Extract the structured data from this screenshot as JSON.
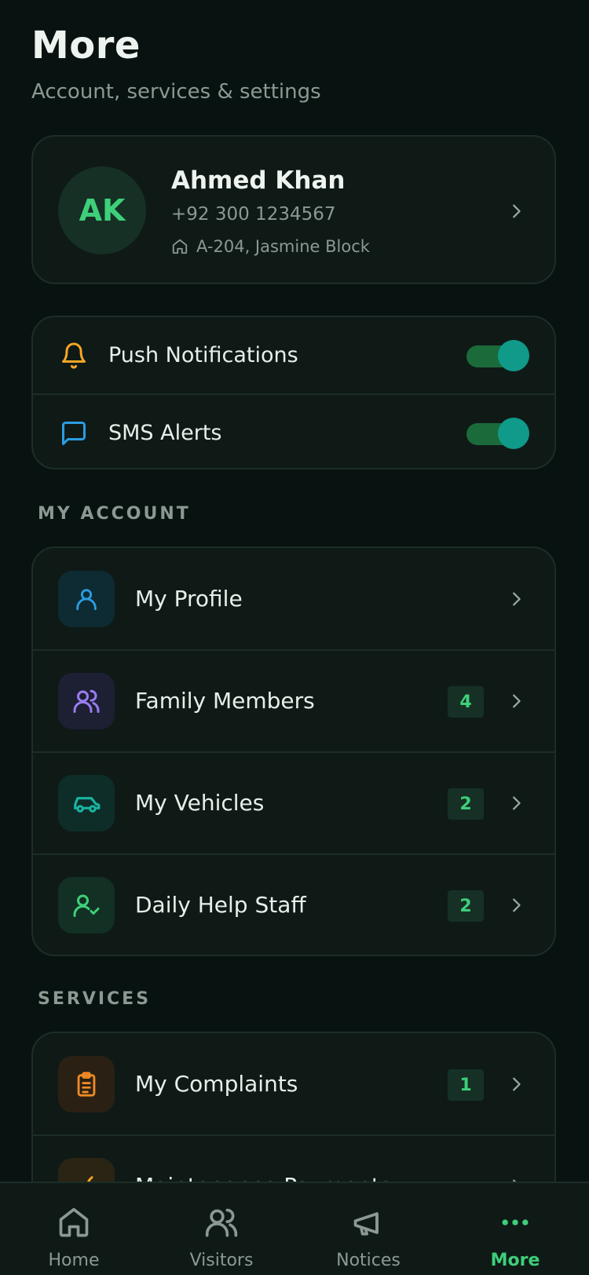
{
  "header": {
    "title": "More",
    "subtitle": "Account, services & settings"
  },
  "profile": {
    "initials": "AK",
    "name": "Ahmed Khan",
    "phone": "+92 300 1234567",
    "address": "A-204, Jasmine Block",
    "icons": {
      "address": "home-icon",
      "chevron": "chevron-right-icon"
    }
  },
  "toggles": [
    {
      "label": "Push Notifications",
      "on": true,
      "icon": "bell-icon",
      "icon_color": "#f5a623"
    },
    {
      "label": "SMS Alerts",
      "on": true,
      "icon": "message-icon",
      "icon_color": "#2b9de0"
    }
  ],
  "sections": {
    "account": {
      "label": "MY ACCOUNT",
      "items": [
        {
          "label": "My Profile",
          "badge": "",
          "icon": "user-icon",
          "color": "#2b9de0",
          "bg": "#0e2a33"
        },
        {
          "label": "Family Members",
          "badge": "4",
          "icon": "users-icon",
          "color": "#9b7cf2",
          "bg": "#1d1f33"
        },
        {
          "label": "My Vehicles",
          "badge": "2",
          "icon": "car-icon",
          "color": "#19b3a0",
          "bg": "#0e2d28"
        },
        {
          "label": "Daily Help Staff",
          "badge": "2",
          "icon": "user-check-icon",
          "color": "#3ecf7a",
          "bg": "#123023"
        }
      ]
    },
    "services": {
      "label": "SERVICES",
      "items": [
        {
          "label": "My Complaints",
          "badge": "1",
          "icon": "clipboard-icon",
          "color": "#f08a24",
          "bg": "#2a2114"
        },
        {
          "label": "Maintenance Payments",
          "badge": "",
          "icon": "wrench-icon",
          "color": "#f5a623",
          "bg": "#2a2414"
        }
      ]
    }
  },
  "nav": [
    {
      "label": "Home",
      "icon": "home-icon",
      "active": false
    },
    {
      "label": "Visitors",
      "icon": "users-icon",
      "active": false
    },
    {
      "label": "Notices",
      "icon": "megaphone-icon",
      "active": false
    },
    {
      "label": "More",
      "icon": "more-dots-icon",
      "active": true
    }
  ],
  "colors": {
    "accent": "#3ecf7a",
    "background": "#081210",
    "card": "#0f1a17",
    "toggle_track": "#1b6b3a",
    "toggle_knob": "#0f9a8a",
    "muted_text": "#8a9a92"
  }
}
